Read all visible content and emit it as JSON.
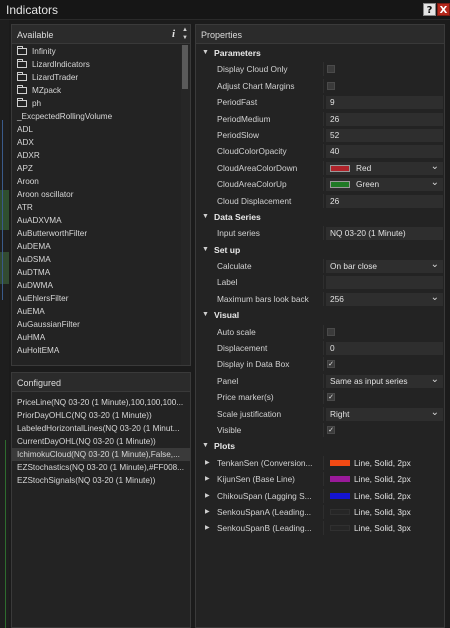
{
  "window": {
    "title": "Indicators",
    "help_label": "?",
    "close_label": "X"
  },
  "available": {
    "header": "Available",
    "info_label": "i",
    "updown_label": "▲\n▼",
    "items": [
      {
        "label": "Infinity",
        "folder": true
      },
      {
        "label": "LizardIndicators",
        "folder": true
      },
      {
        "label": "LizardTrader",
        "folder": true
      },
      {
        "label": "MZpack",
        "folder": true
      },
      {
        "label": "ph",
        "folder": true
      },
      {
        "label": "_ExcpectedRollingVolume",
        "folder": false
      },
      {
        "label": "ADL",
        "folder": false
      },
      {
        "label": "ADX",
        "folder": false
      },
      {
        "label": "ADXR",
        "folder": false
      },
      {
        "label": "APZ",
        "folder": false
      },
      {
        "label": "Aroon",
        "folder": false
      },
      {
        "label": "Aroon oscillator",
        "folder": false
      },
      {
        "label": "ATR",
        "folder": false
      },
      {
        "label": "AuADXVMA",
        "folder": false
      },
      {
        "label": "AuButterworthFilter",
        "folder": false
      },
      {
        "label": "AuDEMA",
        "folder": false
      },
      {
        "label": "AuDSMA",
        "folder": false
      },
      {
        "label": "AuDTMA",
        "folder": false
      },
      {
        "label": "AuDWMA",
        "folder": false
      },
      {
        "label": "AuEhlersFilter",
        "folder": false
      },
      {
        "label": "AuEMA",
        "folder": false
      },
      {
        "label": "AuGaussianFilter",
        "folder": false
      },
      {
        "label": "AuHMA",
        "folder": false
      },
      {
        "label": "AuHoltEMA",
        "folder": false
      }
    ]
  },
  "configured": {
    "header": "Configured",
    "items": [
      {
        "label": "PriceLine(NQ 03-20 (1 Minute),100,100,100...",
        "selected": false
      },
      {
        "label": "PriorDayOHLC(NQ 03-20 (1 Minute))",
        "selected": false
      },
      {
        "label": "LabeledHorizontalLines(NQ 03-20 (1 Minut...",
        "selected": false
      },
      {
        "label": "CurrentDayOHL(NQ 03-20 (1 Minute))",
        "selected": false
      },
      {
        "label": "IchimokuCloud(NQ 03-20 (1 Minute),False,...",
        "selected": true
      },
      {
        "label": "EZStochastics(NQ 03-20 (1 Minute),#FF008...",
        "selected": false
      },
      {
        "label": "EZStochSignals(NQ 03-20 (1 Minute))",
        "selected": false
      }
    ]
  },
  "properties": {
    "header": "Properties",
    "rows": [
      {
        "kind": "cat",
        "label": "Parameters"
      },
      {
        "kind": "check",
        "label": "Display Cloud Only",
        "checked": false
      },
      {
        "kind": "check",
        "label": "Adjust Chart Margins",
        "checked": false
      },
      {
        "kind": "text",
        "label": "PeriodFast",
        "value": "9"
      },
      {
        "kind": "text",
        "label": "PeriodMedium",
        "value": "26"
      },
      {
        "kind": "text",
        "label": "PeriodSlow",
        "value": "52"
      },
      {
        "kind": "text",
        "label": "CloudColorOpacity",
        "value": "40"
      },
      {
        "kind": "color",
        "label": "CloudAreaColorDown",
        "value": "Red",
        "color": "#b0232a"
      },
      {
        "kind": "color",
        "label": "CloudAreaColorUp",
        "value": "Green",
        "color": "#1f7a25"
      },
      {
        "kind": "text",
        "label": "Cloud Displacement",
        "value": "26"
      },
      {
        "kind": "cat",
        "label": "Data Series"
      },
      {
        "kind": "text",
        "label": "Input series",
        "value": "NQ 03-20 (1 Minute)"
      },
      {
        "kind": "cat",
        "label": "Set up"
      },
      {
        "kind": "select",
        "label": "Calculate",
        "value": "On bar close"
      },
      {
        "kind": "text",
        "label": "Label",
        "value": ""
      },
      {
        "kind": "select",
        "label": "Maximum bars look back",
        "value": "256"
      },
      {
        "kind": "cat",
        "label": "Visual"
      },
      {
        "kind": "check",
        "label": "Auto scale",
        "checked": false
      },
      {
        "kind": "text",
        "label": "Displacement",
        "value": "0"
      },
      {
        "kind": "check",
        "label": "Display in Data Box",
        "checked": true
      },
      {
        "kind": "select",
        "label": "Panel",
        "value": "Same as input series"
      },
      {
        "kind": "check",
        "label": "Price marker(s)",
        "checked": true
      },
      {
        "kind": "select",
        "label": "Scale justification",
        "value": "Right"
      },
      {
        "kind": "check",
        "label": "Visible",
        "checked": true
      },
      {
        "kind": "cat",
        "label": "Plots"
      },
      {
        "kind": "plot",
        "label": "TenkanSen (Conversion...",
        "value": "Line, Solid, 2px",
        "color": "#f24a14"
      },
      {
        "kind": "plot",
        "label": "KijunSen (Base Line)",
        "value": "Line, Solid, 2px",
        "color": "#9a1a9a"
      },
      {
        "kind": "plot",
        "label": "ChikouSpan (Lagging S...",
        "value": "Line, Solid, 2px",
        "color": "#1414d2"
      },
      {
        "kind": "plot",
        "label": "SenkouSpanA (Leading...",
        "value": "Line, Solid, 3px",
        "color": "#262626"
      },
      {
        "kind": "plot",
        "label": "SenkouSpanB (Leading...",
        "value": "Line, Solid, 3px",
        "color": "#262626"
      }
    ]
  }
}
